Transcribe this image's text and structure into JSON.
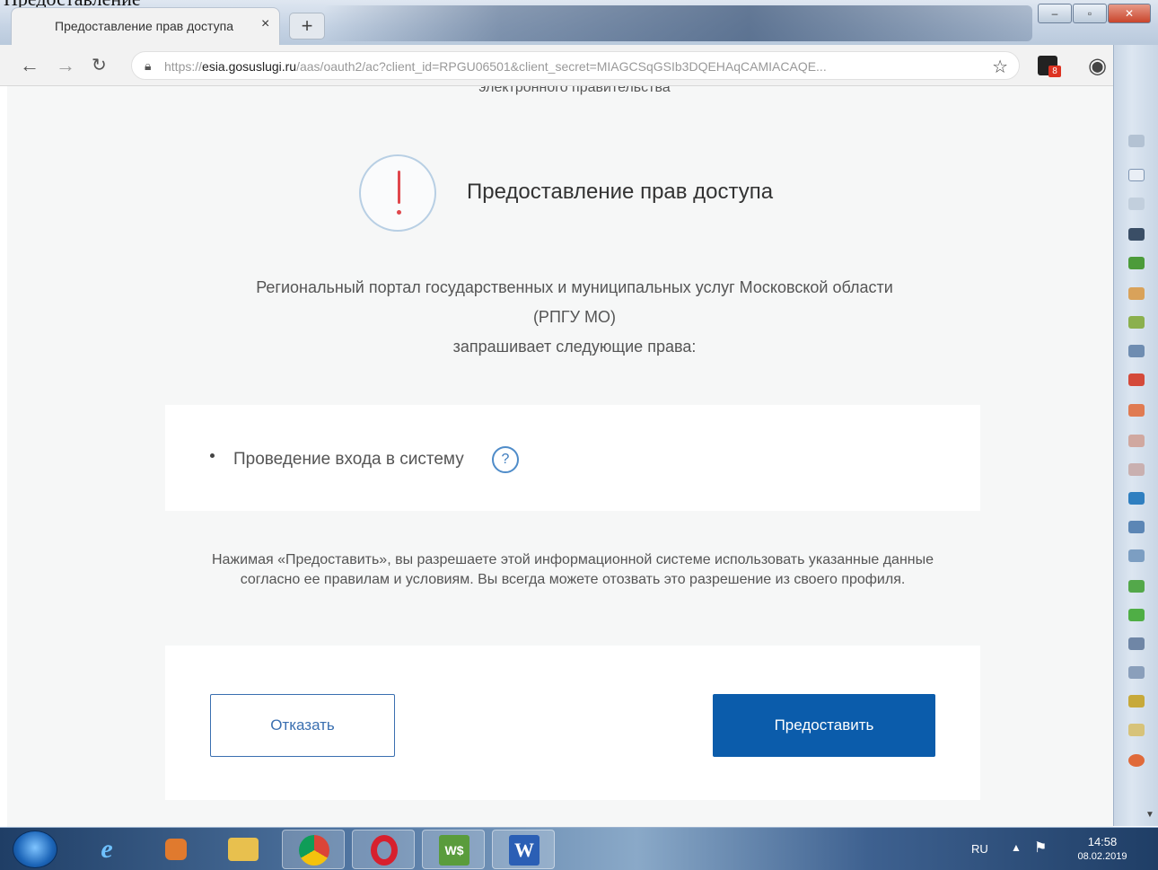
{
  "document_fragment": "Предоставление",
  "browser": {
    "tab_title": "Предоставление прав доступа",
    "tab_close": "×",
    "new_tab": "+",
    "url_scheme": "https://",
    "url_host": "esia.gosuslugi.ru",
    "url_path": "/aas/oauth2/ac?client_id=RPGU06501&client_secret=MIAGCSqGSIb3DQEHAqCAMIACAQE..."
  },
  "page": {
    "cut_heading": "электронного правительства",
    "title": "Предоставление прав доступа",
    "requester_line1": "Региональный портал государственных и муниципальных услуг Московской области",
    "requester_line2": "(РПГУ МО)",
    "requester_line3": "запрашивает следующие права:",
    "permission": "Проведение входа в систему",
    "help_glyph": "?",
    "notice": "Нажимая «Предоставить», вы разрешаете этой информационной системе использовать указанные данные согласно ее правилам и условиям. Вы всегда можете отозвать это разрешение из своего профиля.",
    "refuse_label": "Отказать",
    "grant_label": "Предоставить"
  },
  "taskbar": {
    "language": "RU",
    "time": "14:58",
    "date": "08.02.2019",
    "word_glyph": "W"
  },
  "colors": {
    "primary": "#0b5cab",
    "outline": "#3a6fb0",
    "alert": "#e0474c",
    "panel_bg": "#f6f7f7"
  },
  "icons": [
    "back-icon",
    "forward-icon",
    "reload-icon",
    "lock-icon",
    "star-icon",
    "profile-icon",
    "help-icon",
    "alert-icon"
  ]
}
